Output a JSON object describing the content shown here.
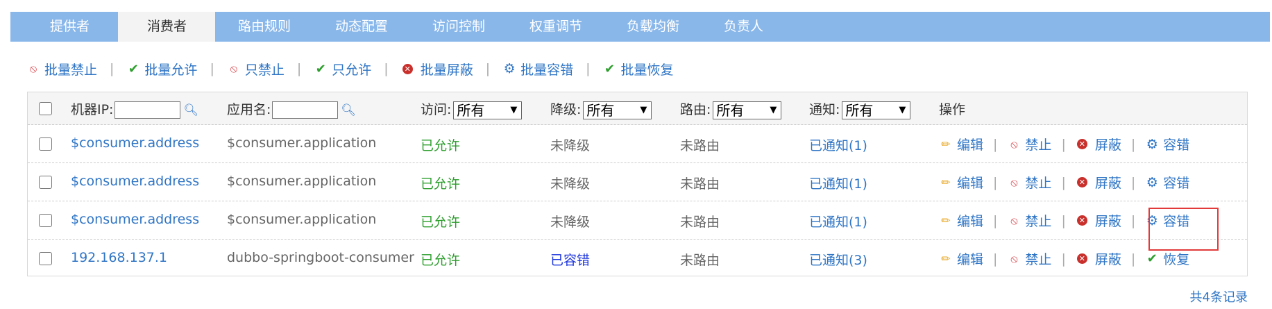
{
  "tabs": [
    "提供者",
    "消费者",
    "路由规则",
    "动态配置",
    "访问控制",
    "权重调节",
    "负载均衡",
    "负责人"
  ],
  "toolbar": [
    {
      "icon": "ban-icon",
      "label": "批量禁止"
    },
    {
      "icon": "check-icon",
      "label": "批量允许"
    },
    {
      "icon": "ban-icon",
      "label": "只禁止"
    },
    {
      "icon": "check-icon",
      "label": "只允许"
    },
    {
      "icon": "x-circle-icon",
      "label": "批量屏蔽"
    },
    {
      "icon": "gear-icon",
      "label": "批量容错"
    },
    {
      "icon": "check-icon",
      "label": "批量恢复"
    }
  ],
  "header": {
    "ip_label": "机器IP:",
    "app_label": "应用名:",
    "access_label": "访问:",
    "access_value": "所有",
    "degrade_label": "降级:",
    "degrade_value": "所有",
    "route_label": "路由:",
    "route_value": "所有",
    "notify_label": "通知:",
    "notify_value": "所有",
    "ops_label": "操作"
  },
  "rows": [
    {
      "address": "$consumer.address",
      "application": "$consumer.application",
      "access": "已允许",
      "degrade": "未降级",
      "route": "未路由",
      "notify": "已通知(1)",
      "ops": [
        "编辑",
        "禁止",
        "屏蔽",
        "容错"
      ]
    },
    {
      "address": "$consumer.address",
      "application": "$consumer.application",
      "access": "已允许",
      "degrade": "未降级",
      "route": "未路由",
      "notify": "已通知(1)",
      "ops": [
        "编辑",
        "禁止",
        "屏蔽",
        "容错"
      ]
    },
    {
      "address": "$consumer.address",
      "application": "$consumer.application",
      "access": "已允许",
      "degrade": "未降级",
      "route": "未路由",
      "notify": "已通知(1)",
      "ops": [
        "编辑",
        "禁止",
        "屏蔽",
        "容错"
      ]
    },
    {
      "address": "192.168.137.1",
      "application": "dubbo-springboot-consumer",
      "access": "已允许",
      "degrade": "已容错",
      "route": "未路由",
      "notify": "已通知(3)",
      "ops": [
        "编辑",
        "禁止",
        "屏蔽",
        "恢复"
      ]
    }
  ],
  "footer": "共4条记录",
  "colors": {
    "tab_bar": "#89b7ea",
    "link": "#2f75c5",
    "allowed": "#2c9e2c",
    "fault_tolerant": "#1a33dd",
    "highlight": "#e23a3a"
  }
}
